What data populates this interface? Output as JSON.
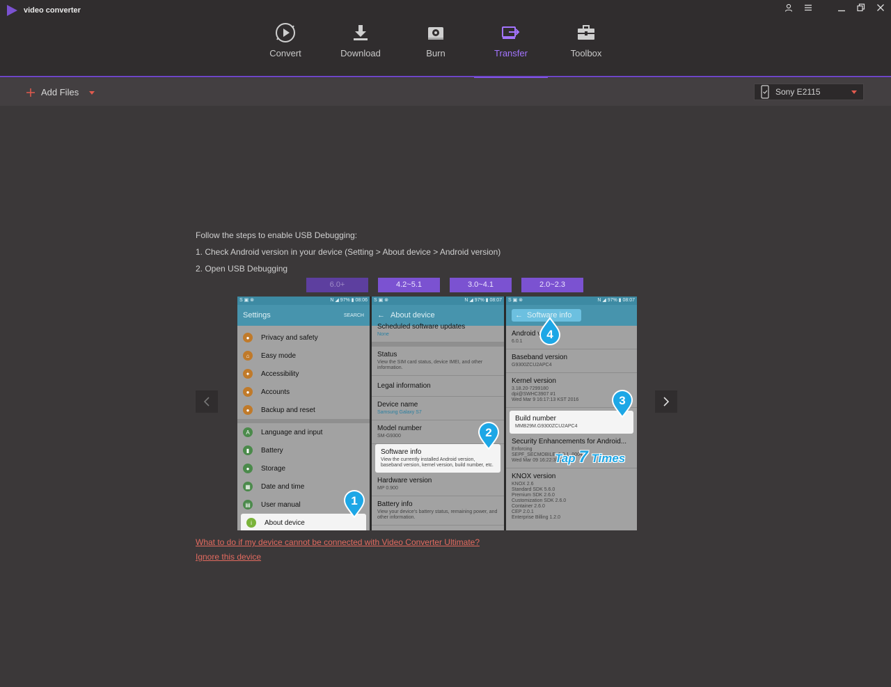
{
  "app": {
    "title": "video converter"
  },
  "nav": {
    "items": [
      {
        "label": "Convert",
        "icon": "convert-icon"
      },
      {
        "label": "Download",
        "icon": "download-icon"
      },
      {
        "label": "Burn",
        "icon": "burn-icon"
      },
      {
        "label": "Transfer",
        "icon": "transfer-icon",
        "active": true
      },
      {
        "label": "Toolbox",
        "icon": "toolbox-icon"
      }
    ]
  },
  "toolbar": {
    "add_files": "Add Files",
    "device": "Sony E2115"
  },
  "instructions": {
    "intro": "Follow the steps to enable USB Debugging:",
    "step1": "1. Check Android version in your device (Setting > About device > Android version)",
    "step2": "2. Open USB Debugging"
  },
  "versions": [
    "6.0+",
    "4.2~5.1",
    "3.0~4.1",
    "2.0~2.3"
  ],
  "guide": {
    "status_left": "S ▣ ⊗",
    "screen1": {
      "time": "N ◢ 97% ▮ 08:06",
      "title": "Settings",
      "action": "SEARCH",
      "items": [
        "Privacy and safety",
        "Easy mode",
        "Accessibility",
        "Accounts",
        "Backup and reset"
      ],
      "items2": [
        "Language and input",
        "Battery",
        "Storage",
        "Date and time",
        "User manual",
        "About device"
      ]
    },
    "screen2": {
      "time": "N ◢ 97% ▮ 08:07",
      "title": "About device",
      "top_partial": "Scheduled software updates",
      "top_sub": "None",
      "items": [
        {
          "t": "Status",
          "s": "View the SIM card status, device IMEI, and other information."
        },
        {
          "t": "Legal information",
          "s": ""
        },
        {
          "t": "Device name",
          "s": "Samsung Galaxy S7"
        },
        {
          "t": "Model number",
          "s": "SM-G9300"
        },
        {
          "t": "Software info",
          "s": "View the currently installed Android version, baseband version, kernel version, build number, etc."
        },
        {
          "t": "Hardware version",
          "s": "MP 0.900"
        },
        {
          "t": "Battery info",
          "s": "View your device's battery status, remaining power, and other information."
        }
      ]
    },
    "screen3": {
      "time": "N ◢ 97% ▮ 08:07",
      "title": "Software info",
      "items": [
        {
          "t": "Android version",
          "s": "6.0.1"
        },
        {
          "t": "Baseband version",
          "s": "G9300ZCU2APC4"
        },
        {
          "t": "Kernel version",
          "s": "3.18.20-7299180\ndpi@SWHC3907 #1\nWed Mar 9 16:17:13 KST 2016"
        },
        {
          "t": "Build number",
          "s": "MMB29M.G9300ZCU2APC4"
        },
        {
          "t": "Security Enhancements for Android...",
          "s": "Enforcing\nSEPF_SECMOBILE_6.0.1_0004\nWed Mar 09 16:22:38 2016"
        },
        {
          "t": "KNOX version",
          "s": "KNOX 2.6\nStandard SDK 5.6.0\nPremium SDK 2.6.0\nCustomization SDK 2.6.0\nContainer 2.6.0\nCEP 2.0.1\nEnterprise Billing 1.2.0"
        }
      ]
    },
    "markers": [
      "1",
      "2",
      "3",
      "4"
    ],
    "tap_prefix": "Tap",
    "tap_number": "7",
    "tap_suffix": "Times"
  },
  "links": {
    "help": "What to do if my device cannot be connected with Video Converter Ultimate?",
    "ignore": "Ignore this device"
  },
  "colors": {
    "accent": "#8a5cf5",
    "link": "#e26a5f",
    "marker": "#1da7e6"
  }
}
